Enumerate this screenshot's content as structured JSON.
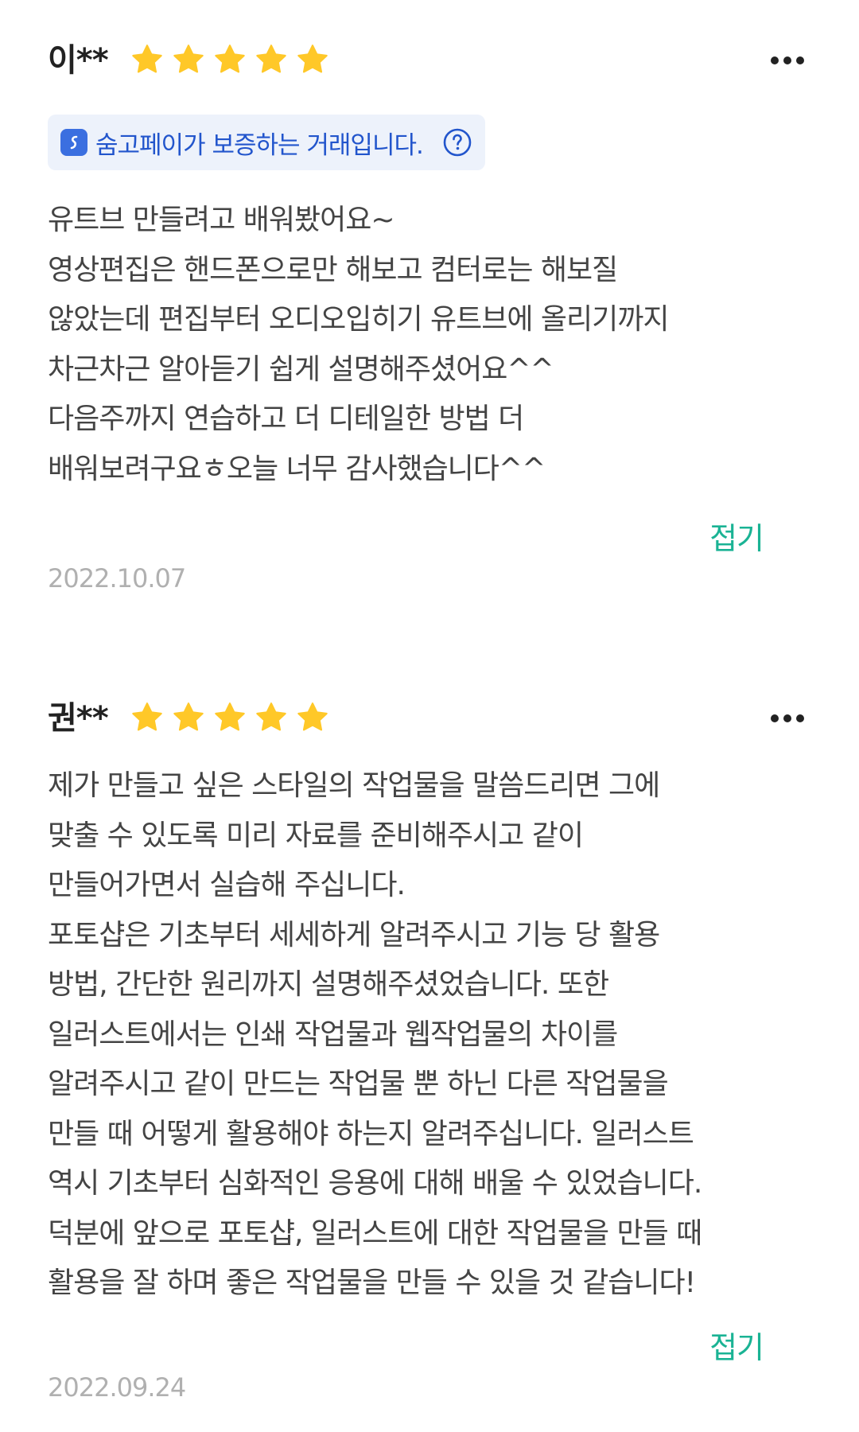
{
  "reviews": [
    {
      "name": "이**",
      "rating": 5,
      "guarantee_text": "숨고페이가 보증하는 거래입니다.",
      "lines": [
        "유트브 만들려고 배워봤어요~",
        "영상편집은 핸드폰으로만 해보고 컴터로는 해보질",
        "않았는데 편집부터 오디오입히기 유트브에 올리기까지",
        "차근차근 알아듣기 쉽게 설명해주셨어요^^",
        "다음주까지 연습하고 더 디테일한 방법 더",
        "배워보려구요ㅎ오늘 너무 감사했습니다^^"
      ],
      "collapse_label": "접기",
      "date": "2022.10.07"
    },
    {
      "name": "권**",
      "rating": 5,
      "lines": [
        "제가 만들고 싶은 스타일의 작업물을 말씀드리면 그에",
        "맞출 수 있도록 미리 자료를 준비해주시고 같이",
        "만들어가면서 실습해 주십니다.",
        "포토샵은 기초부터 세세하게 알려주시고 기능 당 활용",
        "방법, 간단한 원리까지 설명해주셨었습니다. 또한",
        "일러스트에서는 인쇄 작업물과 웹작업물의 차이를",
        "알려주시고 같이 만드는 작업물 뿐 하닌 다른 작업물을",
        "만들 때 어떻게 활용해야 하는지 알려주십니다. 일러스트",
        "역시 기초부터 심화적인 응용에 대해 배울 수 있었습니다.",
        "덕분에 앞으로 포토샵, 일러스트에 대한 작업물을 만들 때",
        "활용을 잘 하며 좋은 작업물을 만들 수 있을 것 같습니다!"
      ],
      "collapse_label": "접기",
      "date": "2022.09.24"
    }
  ],
  "icons": {
    "star": "star-icon",
    "more": "more-icon",
    "pay_logo": "soomgo-pay-icon",
    "help": "question-circle-icon"
  },
  "colors": {
    "star": "#FFC828",
    "accent": "#1AB394",
    "badge_bg": "#EDF2FB",
    "badge_text": "#2255CC",
    "date": "#B0B0B0"
  }
}
